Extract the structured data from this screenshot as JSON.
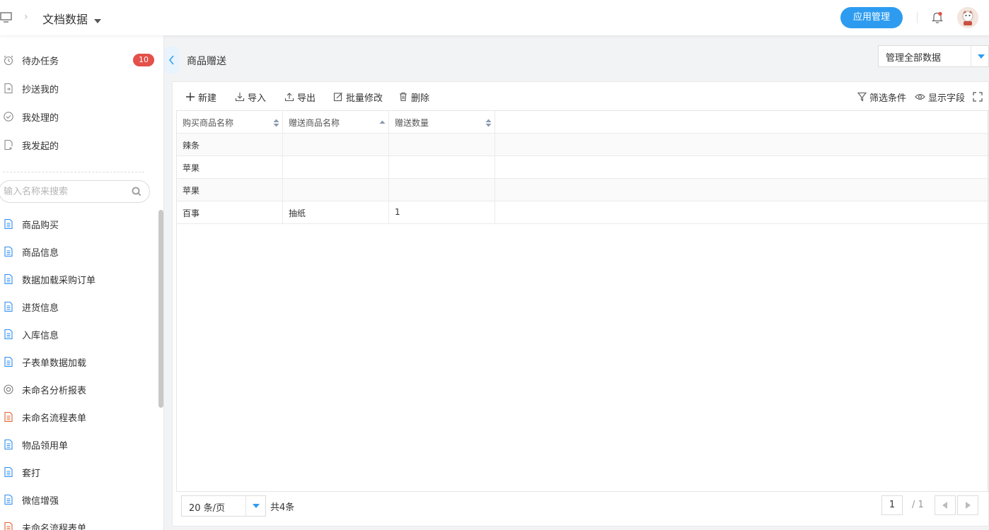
{
  "header": {
    "title": "文档数据",
    "app_manage_label": "应用管理"
  },
  "sidebar": {
    "tasks": [
      {
        "label": "待办任务",
        "icon": "alarm-clock-icon",
        "badge": "10"
      },
      {
        "label": "抄送我的",
        "icon": "cc-icon"
      },
      {
        "label": "我处理的",
        "icon": "check-circle-icon"
      },
      {
        "label": "我发起的",
        "icon": "initiated-icon"
      }
    ],
    "search_placeholder": "输入名称来搜索",
    "forms": [
      {
        "label": "商品购买",
        "icon": "form-icon"
      },
      {
        "label": "商品信息",
        "icon": "form-icon"
      },
      {
        "label": "数据加载采购订单",
        "icon": "form-icon"
      },
      {
        "label": "进货信息",
        "icon": "form-icon"
      },
      {
        "label": "入库信息",
        "icon": "form-icon"
      },
      {
        "label": "子表单数据加载",
        "icon": "form-icon"
      },
      {
        "label": "未命名分析报表",
        "icon": "report-icon"
      },
      {
        "label": "未命名流程表单",
        "icon": "flow-form-icon"
      },
      {
        "label": "物品领用单",
        "icon": "form-icon"
      },
      {
        "label": "套打",
        "icon": "form-icon"
      },
      {
        "label": "微信增强",
        "icon": "form-icon"
      },
      {
        "label": "未命名流程表单",
        "icon": "flow-form-icon"
      }
    ]
  },
  "content": {
    "page_title": "商品赠送",
    "scope_select": "管理全部数据",
    "toolbar": {
      "new": "新建",
      "import": "导入",
      "export": "导出",
      "batch_edit": "批量修改",
      "delete": "删除",
      "filter": "筛选条件",
      "fields": "显示字段"
    },
    "table": {
      "columns": [
        "购买商品名称",
        "赠送商品名称",
        "赠送数量"
      ],
      "rows": [
        [
          "辣条",
          "",
          ""
        ],
        [
          "苹果",
          "",
          ""
        ],
        [
          "苹果",
          "",
          ""
        ],
        [
          "百事",
          "抽纸",
          "1"
        ]
      ]
    },
    "pagination": {
      "page_size": "20 条/页",
      "total": "共4条",
      "current": "1",
      "total_pages": "/ 1"
    }
  },
  "colors": {
    "accent": "#2d9cf0",
    "badge": "#e4504a",
    "form_icon": "#2d8cf0",
    "flow_form_icon": "#e0622f"
  }
}
